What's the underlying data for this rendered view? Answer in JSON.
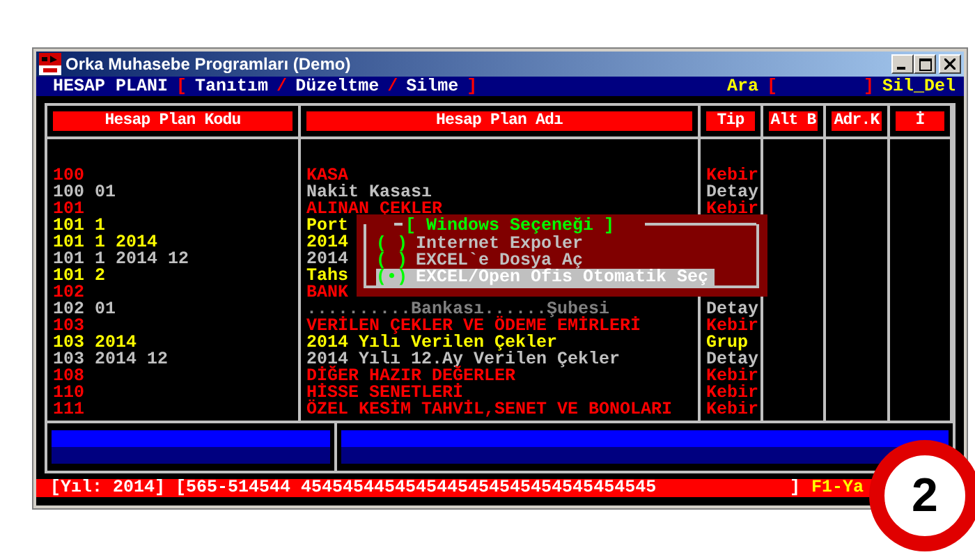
{
  "window": {
    "title": "Orka Muhasebe Programları (Demo)"
  },
  "menu_bar": {
    "left": [
      {
        "text": "HESAP PLANI",
        "color": "#ffffff"
      },
      {
        "text": "[",
        "color": "#ff0000"
      },
      {
        "text": "Tanıtım",
        "color": "#ffffff"
      },
      {
        "text": "/",
        "color": "#ff0000"
      },
      {
        "text": "Düzeltme",
        "color": "#ffffff"
      },
      {
        "text": "/",
        "color": "#ff0000"
      },
      {
        "text": "Silme",
        "color": "#ffffff"
      },
      {
        "text": "]",
        "color": "#ff0000"
      }
    ],
    "right": [
      {
        "text": "Ara",
        "color": "#ffff00"
      },
      {
        "text": "[",
        "color": "#ff0000"
      },
      {
        "text": "]",
        "color": "#ff0000"
      },
      {
        "text": "Sil_Del",
        "color": "#ffff00"
      }
    ]
  },
  "table": {
    "columns": [
      "Hesap Plan Kodu",
      "Hesap Plan Adı",
      "Tip",
      "Alt B",
      "Adr.K",
      "İ"
    ],
    "rows": [
      {
        "code": "100",
        "name": "KASA",
        "tip": "Kebir",
        "color": "#ff0000"
      },
      {
        "code": "100 01",
        "name": "Nakit Kasası",
        "tip": "Detay",
        "color": "#c0c0c0"
      },
      {
        "code": "101",
        "name": "ALINAN ÇEKLER",
        "tip": "Kebir",
        "color": "#ff0000"
      },
      {
        "code": "101 1",
        "name": "Port",
        "color": "#ffff00"
      },
      {
        "code": "101 1 2014",
        "name": "2014",
        "color": "#ffff00"
      },
      {
        "code": "101 1 2014 12",
        "name": "2014",
        "color": "#c0c0c0"
      },
      {
        "code": "101 2",
        "name": "Tahs",
        "color": "#ffff00"
      },
      {
        "code": "102",
        "name": "BANK",
        "color": "#ff0000"
      },
      {
        "code": "102 01",
        "name": "..........Bankası......Şubesi",
        "tip": "Detay",
        "color": "#808080"
      },
      {
        "code": "103",
        "name": "VERİLEN ÇEKLER VE ÖDEME EMİRLERİ",
        "tip": "Kebir",
        "color": "#ff0000"
      },
      {
        "code": "103 2014",
        "name": "2014 Yılı Verilen Çekler",
        "tip": "Grup",
        "color": "#ffff00"
      },
      {
        "code": "103 2014 12",
        "name": "2014 Yılı 12.Ay Verilen Çekler",
        "tip": "Detay",
        "color": "#c0c0c0"
      },
      {
        "code": "108",
        "name": "DİĞER HAZIR DEĞERLER",
        "tip": "Kebir",
        "color": "#ff0000"
      },
      {
        "code": "110",
        "name": "HİSSE SENETLERİ",
        "tip": "Kebir",
        "color": "#ff0000"
      },
      {
        "code": "111",
        "name": "ÖZEL KESİM TAHVİL,SENET VE BONOLARI",
        "tip": "Kebir",
        "color": "#ff0000"
      }
    ]
  },
  "popup": {
    "title": "[ Windows Seçeneği ]",
    "options": [
      {
        "marker": "( )",
        "label": "Internet Expoler",
        "selected": false
      },
      {
        "marker": "( )",
        "label": "EXCEL`e Dosya Aç",
        "selected": false
      },
      {
        "marker": "(•)",
        "label": "EXCEL/Open Ofis Otomatik Seç",
        "selected": true
      }
    ]
  },
  "status_bar": {
    "left": "[Yıl: 2014] [565-514544 4545454454545445454545454545454545",
    "bracket": "]",
    "right": "F1-Ya"
  },
  "badge": "2"
}
